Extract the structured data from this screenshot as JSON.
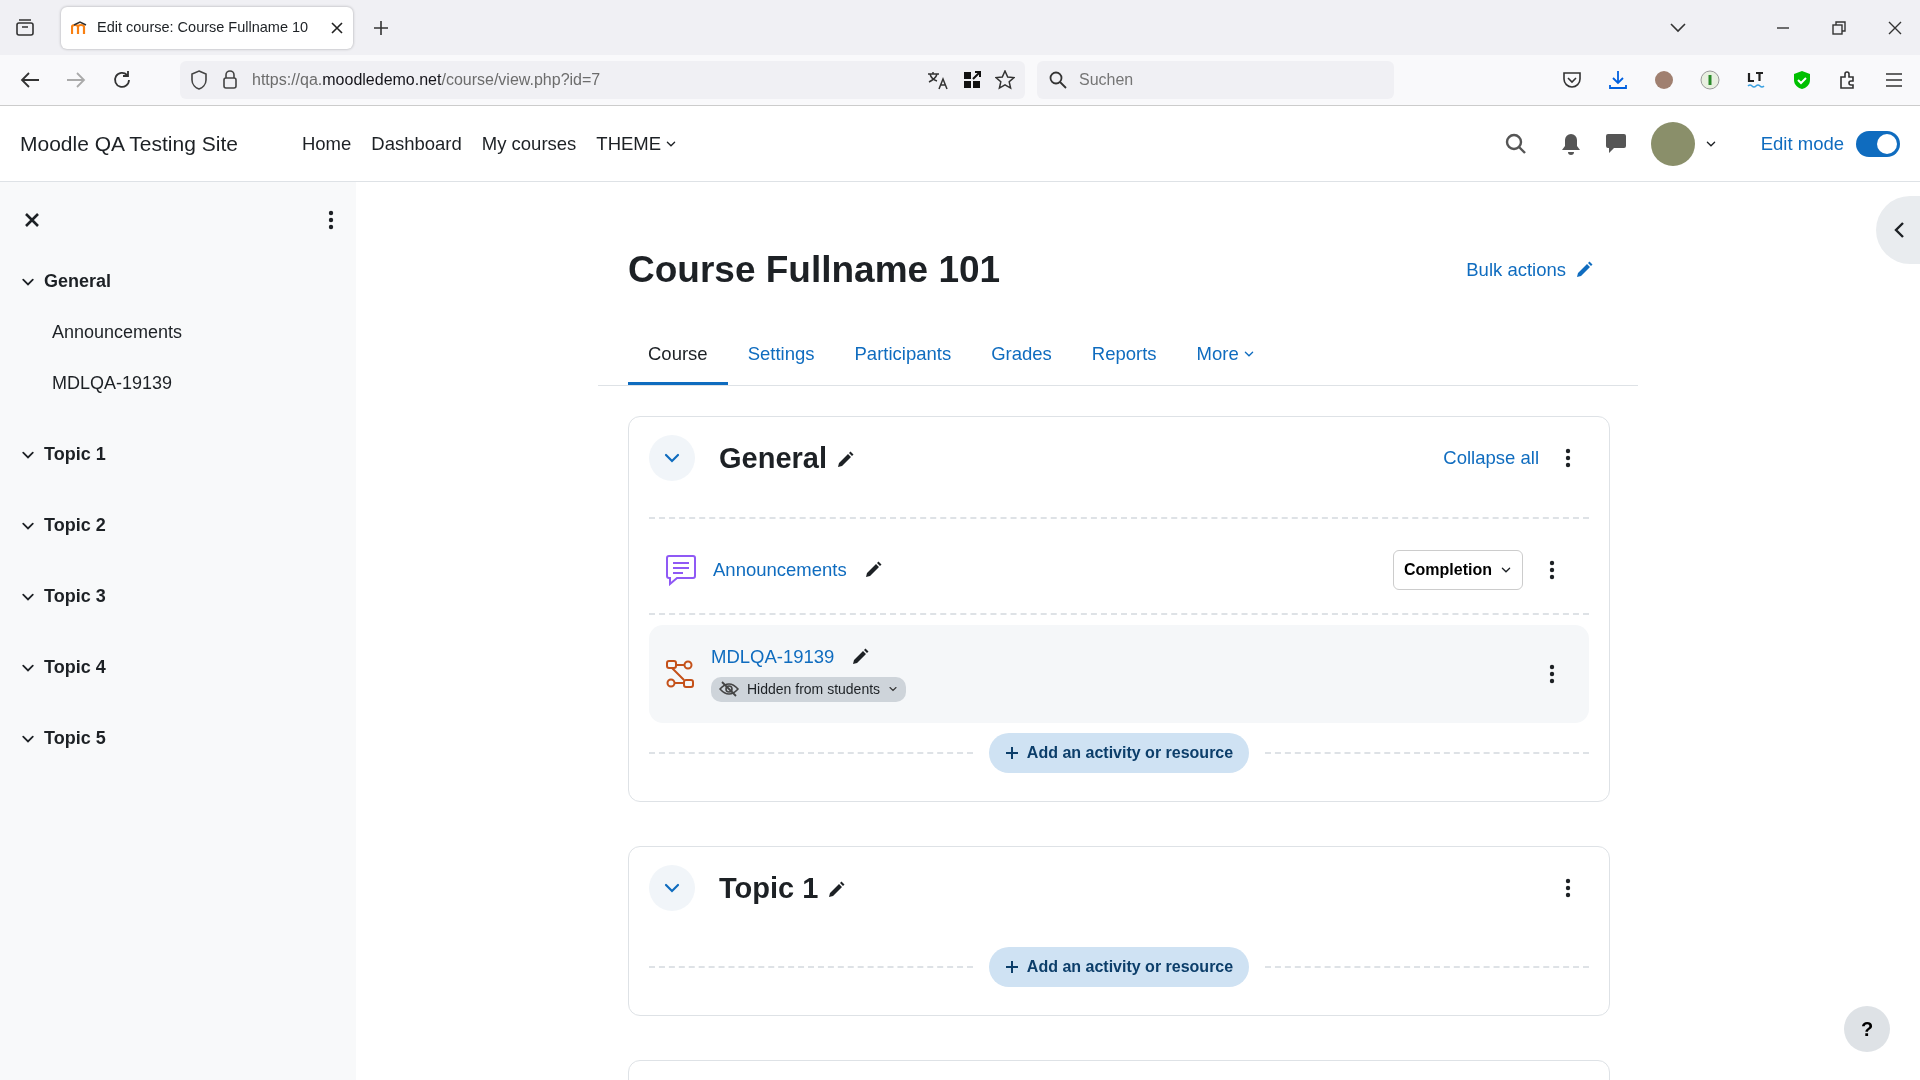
{
  "browser": {
    "tab": {
      "title": "Edit course: Course Fullname 10"
    },
    "url": {
      "scheme": "https://qa.",
      "domain": "moodledemo.net",
      "path": "/course/view.php?id=7"
    },
    "search": {
      "placeholder": "Suchen"
    }
  },
  "navbar": {
    "site_name": "Moodle QA Testing Site",
    "links": [
      {
        "label": "Home",
        "kind": "link"
      },
      {
        "label": "Dashboard",
        "kind": "link"
      },
      {
        "label": "My courses",
        "kind": "link"
      },
      {
        "label": "THEME",
        "kind": "dropdown"
      }
    ],
    "edit_mode": {
      "label": "Edit mode",
      "on": true
    }
  },
  "drawer": {
    "items": [
      {
        "label": "General",
        "expanded": true,
        "children": [
          {
            "label": "Announcements"
          },
          {
            "label": "MDLQA-19139"
          }
        ]
      },
      {
        "label": "Topic 1",
        "expanded": true
      },
      {
        "label": "Topic 2",
        "expanded": true
      },
      {
        "label": "Topic 3",
        "expanded": true
      },
      {
        "label": "Topic 4",
        "expanded": true
      },
      {
        "label": "Topic 5",
        "expanded": true
      }
    ]
  },
  "course": {
    "title": "Course Fullname 101",
    "bulk_actions": "Bulk actions",
    "tabs": [
      {
        "label": "Course",
        "selected": true,
        "kind": "link"
      },
      {
        "label": "Settings",
        "selected": false,
        "kind": "link"
      },
      {
        "label": "Participants",
        "selected": false,
        "kind": "link"
      },
      {
        "label": "Grades",
        "selected": false,
        "kind": "link"
      },
      {
        "label": "Reports",
        "selected": false,
        "kind": "link"
      },
      {
        "label": "More",
        "selected": false,
        "kind": "dropdown"
      }
    ],
    "sections": [
      {
        "title": "General",
        "expanded": true,
        "collapse_all": "Collapse all",
        "activities": [
          {
            "name": "Announcements",
            "kind": "forum",
            "completion": "Completion",
            "hidden": false
          },
          {
            "name": "MDLQA-19139",
            "kind": "subsection",
            "hidden": true,
            "hidden_label": "Hidden from students"
          }
        ],
        "add_label": "Add an activity or resource"
      },
      {
        "title": "Topic 1",
        "expanded": true,
        "add_label": "Add an activity or resource"
      }
    ]
  },
  "help": "?"
}
